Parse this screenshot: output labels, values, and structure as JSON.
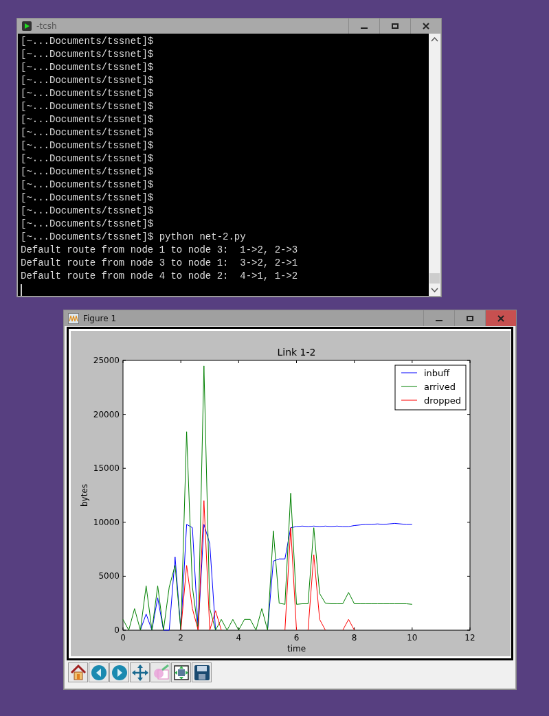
{
  "terminal": {
    "title": "-tcsh",
    "lines": [
      "[~...Documents/tssnet]$",
      "[~...Documents/tssnet]$",
      "[~...Documents/tssnet]$",
      "[~...Documents/tssnet]$",
      "[~...Documents/tssnet]$",
      "[~...Documents/tssnet]$",
      "[~...Documents/tssnet]$",
      "[~...Documents/tssnet]$",
      "[~...Documents/tssnet]$",
      "[~...Documents/tssnet]$",
      "[~...Documents/tssnet]$",
      "[~...Documents/tssnet]$",
      "[~...Documents/tssnet]$",
      "[~...Documents/tssnet]$",
      "[~...Documents/tssnet]$",
      "[~...Documents/tssnet]$ python net-2.py",
      "Default route from node 1 to node 3:  1->2, 2->3",
      "Default route from node 3 to node 1:  3->2, 2->1",
      "Default route from node 4 to node 2:  4->1, 1->2"
    ]
  },
  "figure": {
    "title": "Figure 1",
    "chart_data": {
      "type": "line",
      "title": "Link 1-2",
      "xlabel": "time",
      "ylabel": "bytes",
      "x": [
        0,
        0.2,
        0.4,
        0.6,
        0.8,
        1,
        1.2,
        1.4,
        1.6,
        1.8,
        2,
        2.2,
        2.4,
        2.6,
        2.8,
        3,
        3.2,
        3.4,
        3.6,
        3.8,
        4,
        4.2,
        4.4,
        4.6,
        4.8,
        5,
        5.2,
        5.4,
        5.6,
        5.8,
        6,
        6.2,
        6.4,
        6.6,
        6.8,
        7,
        7.2,
        7.4,
        7.6,
        7.8,
        8,
        8.2,
        8.4,
        8.6,
        8.8,
        9,
        9.2,
        9.4,
        9.6,
        9.8,
        10
      ],
      "series": [
        {
          "name": "inbuff",
          "color": "#0000ff",
          "values": [
            null,
            null,
            null,
            0,
            1500,
            0,
            3000,
            0,
            0,
            6800,
            0,
            9800,
            9500,
            0,
            9800,
            8000,
            0,
            null,
            null,
            null,
            null,
            null,
            null,
            null,
            null,
            0,
            6400,
            6600,
            6600,
            9500,
            9600,
            9650,
            9600,
            9650,
            9600,
            9650,
            9600,
            9650,
            9600,
            9600,
            9700,
            9750,
            9800,
            9800,
            9850,
            9800,
            9850,
            9900,
            9850,
            9800,
            9800
          ]
        },
        {
          "name": "arrived",
          "color": "#008000",
          "values": [
            1000,
            0,
            2000,
            0,
            4100,
            0,
            4100,
            0,
            4000,
            6000,
            0,
            18400,
            4000,
            0,
            24500,
            2000,
            0,
            1000,
            0,
            1000,
            0,
            1000,
            1000,
            0,
            2000,
            0,
            9200,
            2500,
            2400,
            12700,
            2400,
            2450,
            2450,
            9500,
            3400,
            2500,
            2450,
            2450,
            2450,
            3500,
            2450,
            2450,
            2450,
            2450,
            2450,
            2450,
            2450,
            2450,
            2450,
            2450,
            2400
          ]
        },
        {
          "name": "dropped",
          "color": "#ff0000",
          "values": [
            null,
            null,
            null,
            null,
            null,
            null,
            null,
            null,
            null,
            null,
            0,
            6000,
            2000,
            0,
            12000,
            0,
            1800,
            0,
            null,
            null,
            null,
            null,
            null,
            null,
            null,
            null,
            null,
            null,
            0,
            9500,
            0,
            null,
            0,
            7000,
            1000,
            0,
            null,
            null,
            0,
            1000,
            0,
            null,
            null,
            null,
            null,
            null,
            null,
            null,
            null,
            null,
            null
          ]
        }
      ],
      "legend": true,
      "xlim": [
        0,
        12
      ],
      "ylim": [
        0,
        25000
      ],
      "xticks": [
        0,
        2,
        4,
        6,
        8,
        10,
        12
      ],
      "yticks": [
        0,
        5000,
        10000,
        15000,
        20000,
        25000
      ]
    }
  }
}
